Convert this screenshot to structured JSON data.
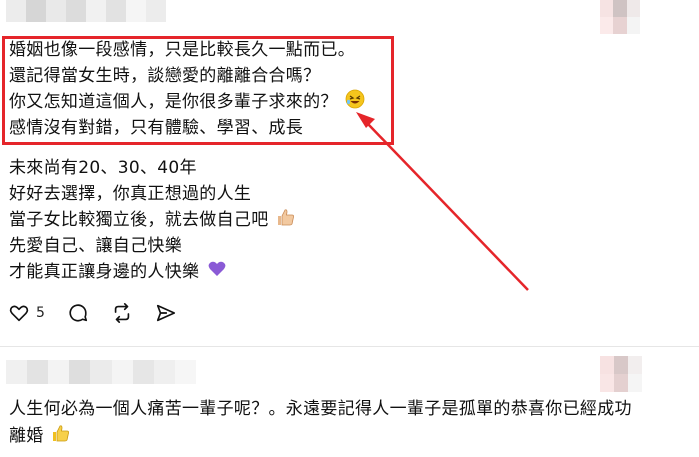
{
  "post": {
    "highlighted_lines": [
      "婚姻也像一段感情，只是比較長久一點而已。",
      "還記得當女生時，談戀愛的離離合合嗎？",
      "你又怎知道這個人，是你很多輩子求來的？",
      "感情沒有對錯，只有體驗、學習、成長"
    ],
    "lines": [
      "未來尚有20、30、40年",
      "好好去選擇，你真正想過的人生",
      "當子女比較獨立後，就去做自己吧",
      "先愛自己、讓自己快樂",
      "才能真正讓身邊的人快樂"
    ],
    "like_count": "5",
    "icons": [
      "heart-icon",
      "comment-icon",
      "repost-icon",
      "share-icon",
      "laughing-emoji",
      "thumbs-up-emoji",
      "purple-heart-emoji"
    ],
    "annotation_color": "#e5252a"
  },
  "comment": {
    "lines": [
      "人生何必為一個人痛苦一輩子呢？。永遠要記得人一輩子是孤單的恭喜你已經成功",
      "離婚"
    ]
  }
}
